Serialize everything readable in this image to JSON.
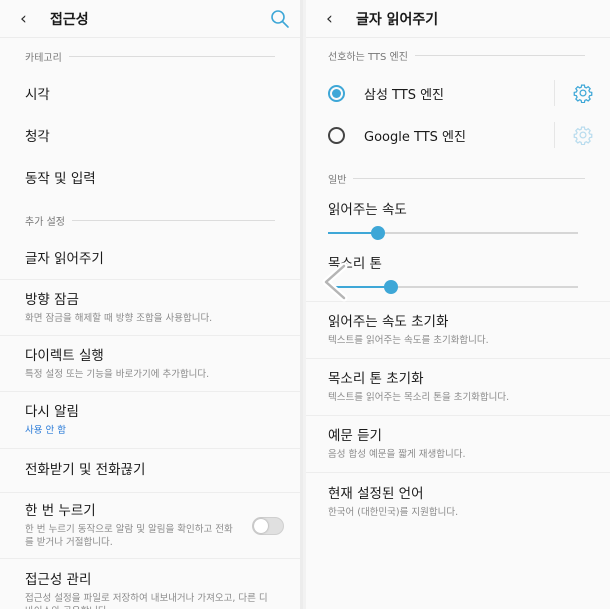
{
  "left": {
    "header": {
      "title": "접근성"
    },
    "category_header": "카테고리",
    "items_top": [
      {
        "label": "시각"
      },
      {
        "label": "청각"
      },
      {
        "label": "동작 및 입력"
      }
    ],
    "additional_header": "추가 설정",
    "items": [
      {
        "label": "글자 읽어주기",
        "sub": ""
      },
      {
        "label": "방향 잠금",
        "sub": "화면 잠금을 해제할 때 방향 조합을 사용합니다."
      },
      {
        "label": "다이렉트 실행",
        "sub": "특정 설정 또는 기능을 바로가기에 추가합니다."
      },
      {
        "label": "다시 알림",
        "sub": "사용 안 함"
      },
      {
        "label": "전화받기 및 전화끊기",
        "sub": ""
      },
      {
        "label": "한 번 누르기",
        "sub": "한 번 누르기 동작으로 알람 및 알림을 확인하고 전화를 받거나 거절합니다.",
        "toggle": false
      },
      {
        "label": "접근성 관리",
        "sub": "접근성 설정을 파일로 저장하여 내보내거나 가져오고, 다른 디바이스와 공유합니다."
      }
    ]
  },
  "right": {
    "header": {
      "title": "글자 읽어주기"
    },
    "tts_header": "선호하는 TTS 엔진",
    "engines": [
      {
        "label": "삼성 TTS 엔진",
        "selected": true
      },
      {
        "label": "Google TTS 엔진",
        "selected": false
      }
    ],
    "general_header": "일반",
    "sliders": [
      {
        "label": "읽어주는 속도",
        "value_fraction": 0.2
      },
      {
        "label": "목소리 톤",
        "value_fraction": 0.25
      }
    ],
    "items": [
      {
        "label": "읽어주는 속도 초기화",
        "sub": "텍스트를 읽어주는 속도를 초기화합니다."
      },
      {
        "label": "목소리 톤 초기화",
        "sub": "텍스트를 읽어주는 목소리 톤을 초기화합니다."
      },
      {
        "label": "예문 듣기",
        "sub": "음성 합성 예문을 짧게 재생합니다."
      },
      {
        "label": "현재 설정된 언어",
        "sub": "한국어 (대한민국)를 지원합니다."
      }
    ]
  },
  "colors": {
    "accent": "#3ea7d7",
    "link_blue": "#2a7bd8",
    "background": "#fafafa"
  },
  "icons": {
    "back": "‹",
    "search": "search-icon",
    "gear": "gear-icon"
  }
}
